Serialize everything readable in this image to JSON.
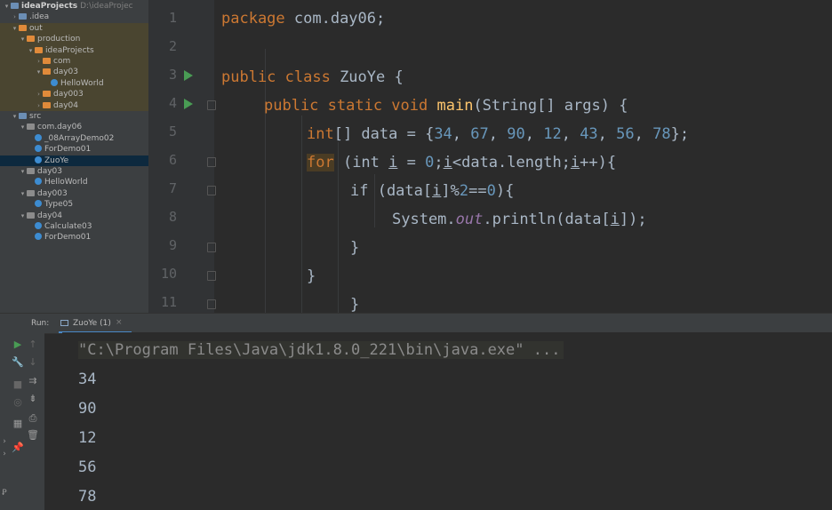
{
  "project_tree": {
    "root_label": "ideaProjects",
    "root_path": "D:\\ideaProjec",
    "items": [
      {
        "label": "ideaProjects",
        "path": "D:\\ideaProjec",
        "indent": 0,
        "arrow": "▾",
        "icon": "folder-blue",
        "style": "bold"
      },
      {
        "label": ".idea",
        "indent": 1,
        "arrow": "›",
        "icon": "folder-blue"
      },
      {
        "label": "out",
        "indent": 1,
        "arrow": "▾",
        "icon": "folder-orange",
        "style": "olive"
      },
      {
        "label": "production",
        "indent": 2,
        "arrow": "▾",
        "icon": "folder-orange",
        "style": "olive"
      },
      {
        "label": "ideaProjects",
        "indent": 3,
        "arrow": "▾",
        "icon": "folder-orange",
        "style": "olive"
      },
      {
        "label": "com",
        "indent": 4,
        "arrow": "›",
        "icon": "folder-orange",
        "style": "olive"
      },
      {
        "label": "day03",
        "indent": 4,
        "arrow": "▾",
        "icon": "folder-orange",
        "style": "olive"
      },
      {
        "label": "HelloWorld",
        "indent": 5,
        "arrow": "",
        "icon": "class",
        "style": "olive"
      },
      {
        "label": "day003",
        "indent": 4,
        "arrow": "›",
        "icon": "folder-orange",
        "style": "olive"
      },
      {
        "label": "day04",
        "indent": 4,
        "arrow": "›",
        "icon": "folder-orange",
        "style": "olive"
      },
      {
        "label": "src",
        "indent": 1,
        "arrow": "▾",
        "icon": "folder-blue"
      },
      {
        "label": "com.day06",
        "indent": 2,
        "arrow": "▾",
        "icon": "package"
      },
      {
        "label": "_08ArrayDemo02",
        "indent": 3,
        "arrow": "",
        "icon": "class"
      },
      {
        "label": "ForDemo01",
        "indent": 3,
        "arrow": "",
        "icon": "class"
      },
      {
        "label": "ZuoYe",
        "indent": 3,
        "arrow": "",
        "icon": "class",
        "style": "selected"
      },
      {
        "label": "day03",
        "indent": 2,
        "arrow": "▾",
        "icon": "package"
      },
      {
        "label": "HelloWorld",
        "indent": 3,
        "arrow": "",
        "icon": "class"
      },
      {
        "label": "day003",
        "indent": 2,
        "arrow": "▾",
        "icon": "package"
      },
      {
        "label": "Type05",
        "indent": 3,
        "arrow": "",
        "icon": "class"
      },
      {
        "label": "day04",
        "indent": 2,
        "arrow": "▾",
        "icon": "package"
      },
      {
        "label": "Calculate03",
        "indent": 3,
        "arrow": "",
        "icon": "class"
      },
      {
        "label": "ForDemo01",
        "indent": 3,
        "arrow": "",
        "icon": "class"
      }
    ]
  },
  "editor": {
    "line_numbers": [
      "1",
      "2",
      "3",
      "4",
      "5",
      "6",
      "7",
      "8",
      "9",
      "10",
      "11"
    ],
    "run_markers_on_lines": [
      3,
      4
    ],
    "lines": {
      "l1_kw": "package",
      "l1_rest": " com.day06;",
      "l3_kw": "public class",
      "l3_rest": " ZuoYe {",
      "l4_kw": "public static void",
      "l4_sp": " ",
      "l4_fn": "main",
      "l4_rest": "(String[] args) {",
      "l5_kw": "int",
      "l5_a": "[] data = {",
      "l5_n1": "34",
      "l5_n2": "67",
      "l5_n3": "90",
      "l5_n4": "12",
      "l5_n5": "43",
      "l5_n6": "56",
      "l5_n7": "78",
      "l5_end": "};",
      "comma": ", ",
      "l6_for": "for",
      "l6_a": " (int ",
      "l6_i1": "i",
      "l6_b": " = ",
      "l6_zero": "0",
      "l6_c": ";",
      "l6_i2": "i",
      "l6_d": "<data.length;",
      "l6_i3": "i",
      "l6_e": "++){",
      "l7_a": "if (data[",
      "l7_i": "i",
      "l7_b": "]%",
      "l7_two": "2",
      "l7_c": "==",
      "l7_zero": "0",
      "l7_d": "){",
      "l8_a": "System.",
      "l8_out": "out",
      "l8_b": ".println(data[",
      "l8_i": "i",
      "l8_c": "]);",
      "brace": "}"
    }
  },
  "run_panel": {
    "label": "Run:",
    "tab_label": "ZuoYe (1)",
    "tab_close": "×",
    "command": "\"C:\\Program Files\\Java\\jdk1.8.0_221\\bin\\java.exe\" ...",
    "output": [
      "34",
      "90",
      "12",
      "56",
      "78"
    ]
  },
  "toolbar_icons": [
    "run-icon",
    "wrench-icon",
    "stop-icon",
    "camera-icon",
    "layout-icon",
    "pin-icon",
    "up-arrow-icon",
    "down-arrow-icon",
    "soft-wrap-icon",
    "scroll-end-icon",
    "print-icon",
    "trash-icon"
  ],
  "colors": {
    "keyword": "#cc7832",
    "function": "#ffc66d",
    "number": "#6897bb",
    "field": "#9876aa",
    "text": "#a9b7c6",
    "run_green": "#499c54",
    "tab_accent": "#4a88c7"
  }
}
